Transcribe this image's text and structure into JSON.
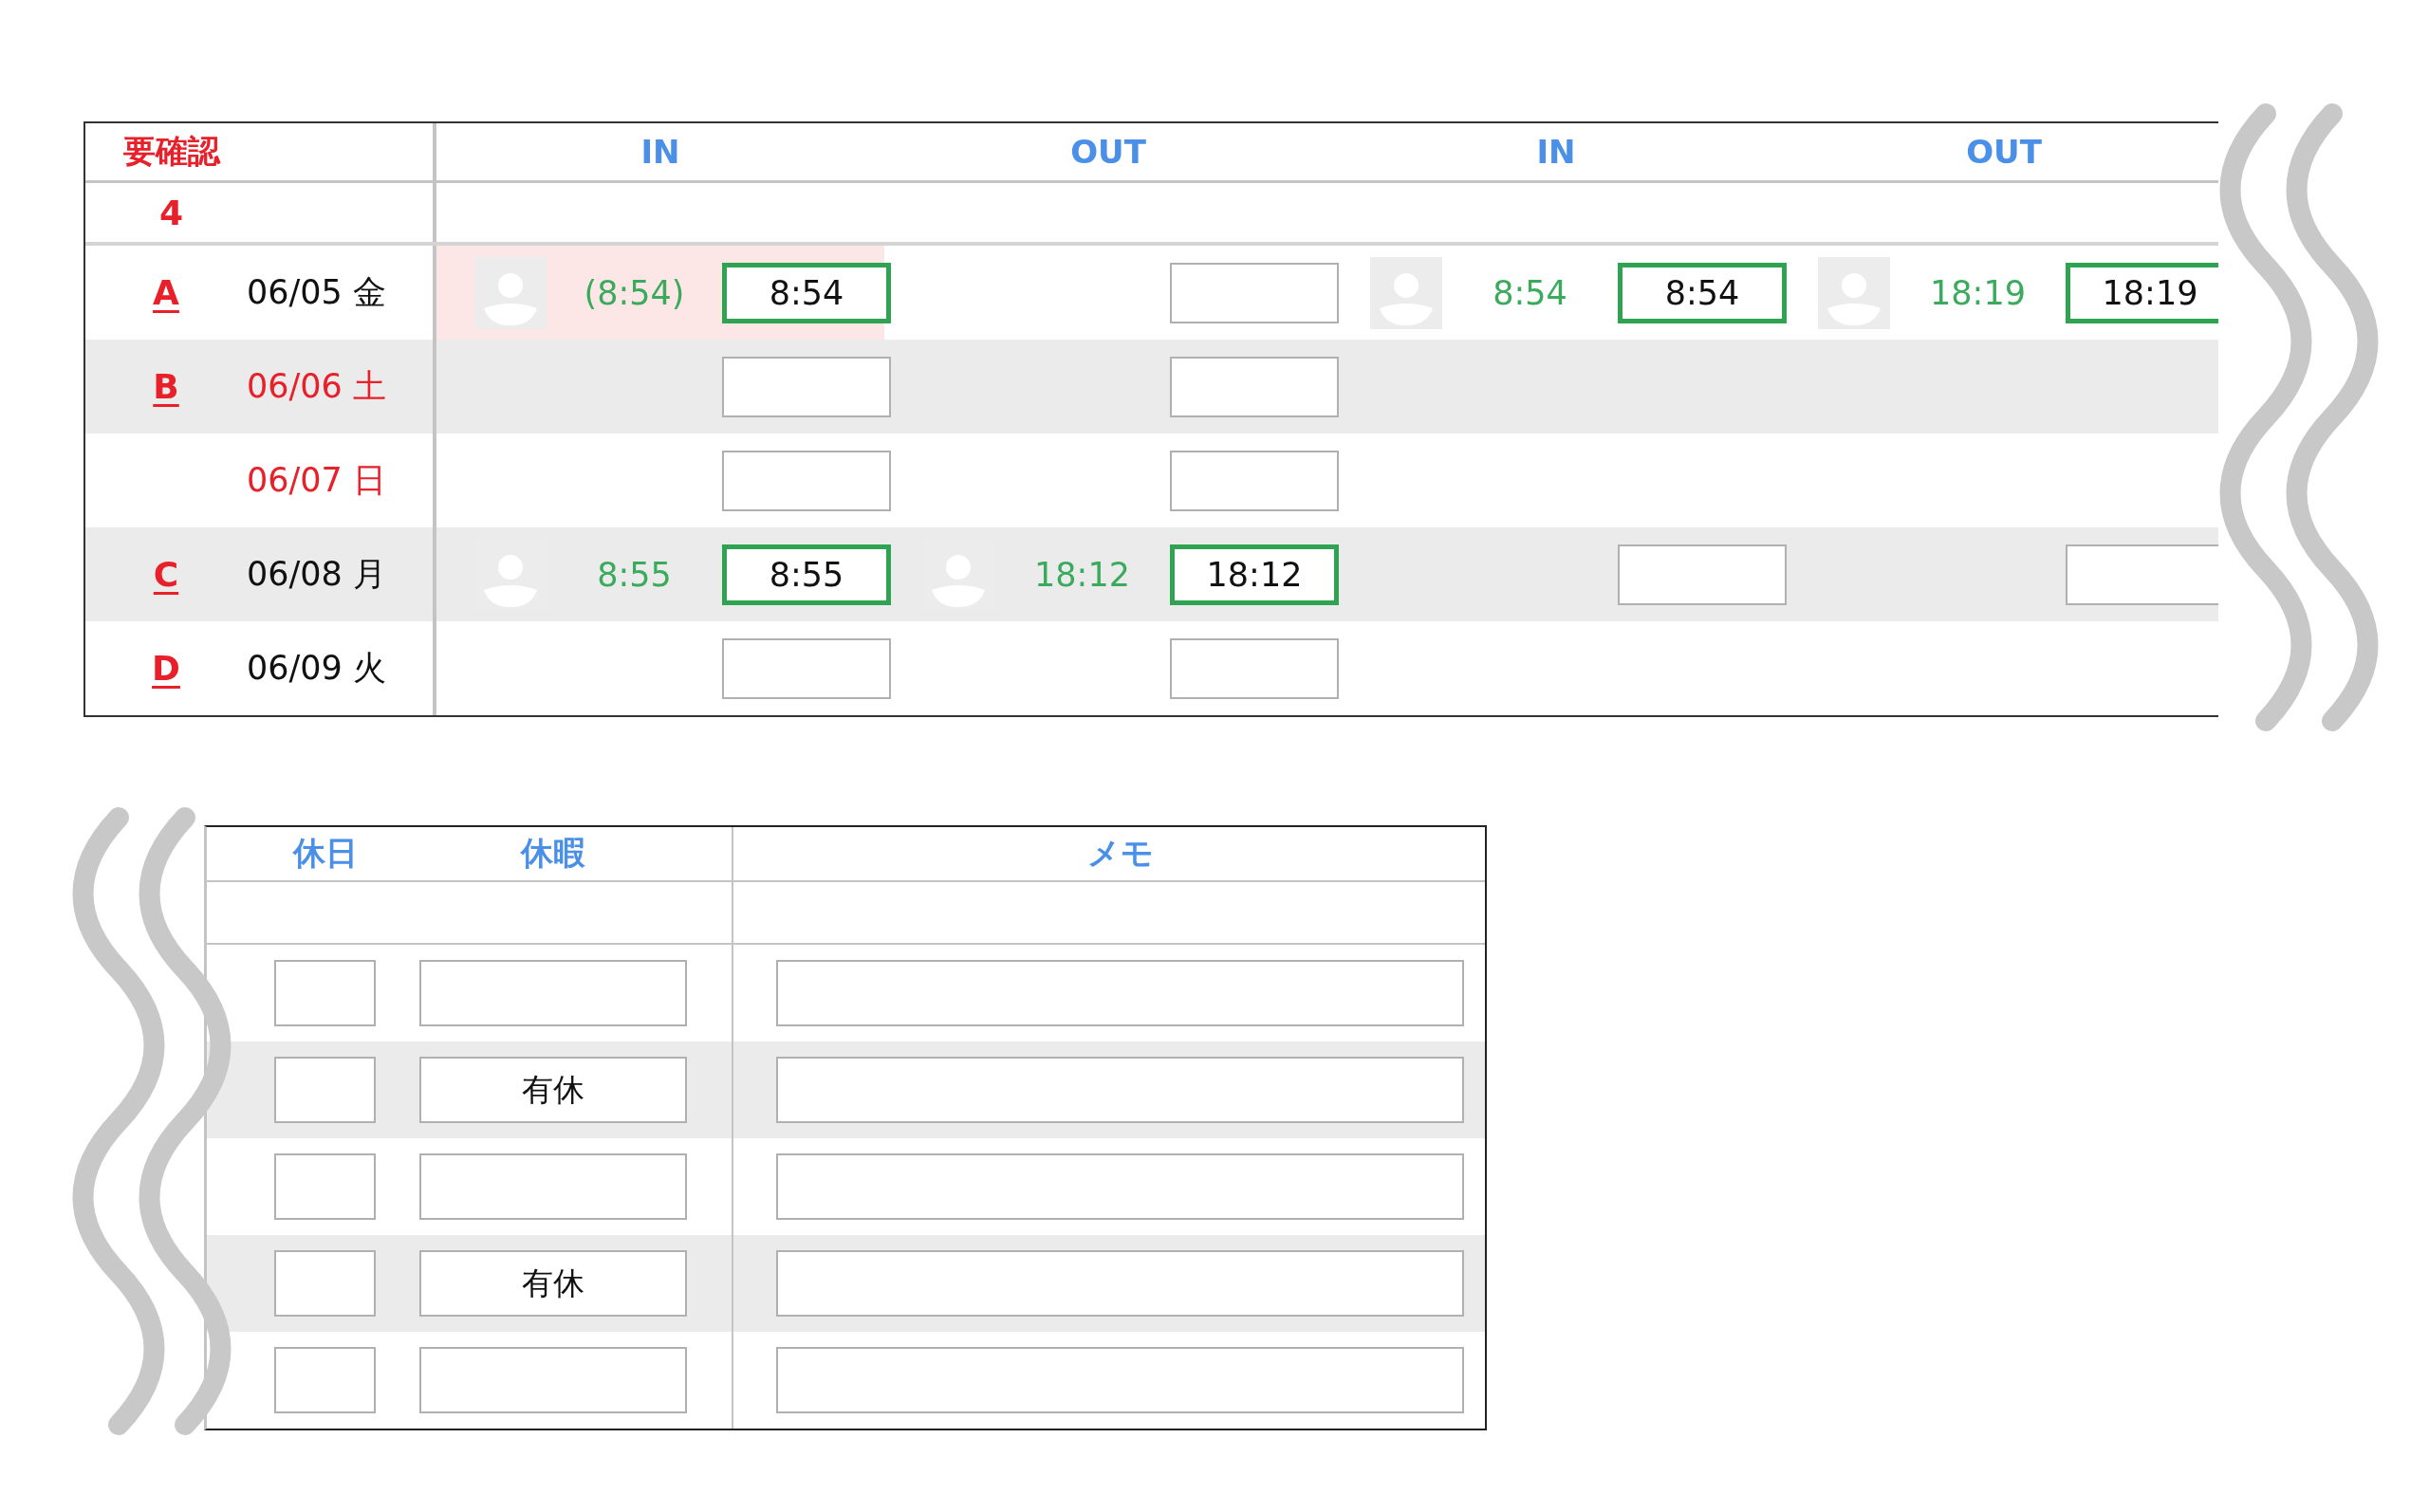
{
  "attendance": {
    "check_header": "要確認",
    "check_count": "4",
    "columns": [
      "IN",
      "OUT",
      "IN",
      "OUT"
    ],
    "rows": [
      {
        "flag": "A",
        "date": "06/05 金",
        "holiday": false,
        "cells": [
          {
            "kind": "entry",
            "photo": true,
            "reading": "(8:54)",
            "value": "8:54",
            "verified": true,
            "flagged": true
          },
          {
            "kind": "entry",
            "photo": false,
            "verified": false,
            "flagged": false
          },
          {
            "kind": "entry",
            "photo": true,
            "reading": "8:54",
            "value": "8:54",
            "verified": true,
            "flagged": false
          },
          {
            "kind": "entry",
            "photo": true,
            "reading": "18:19",
            "value": "18:19",
            "verified": true,
            "flagged": false
          }
        ]
      },
      {
        "flag": "B",
        "date": "06/06 土",
        "holiday": true,
        "cells": [
          {
            "kind": "entry",
            "photo": false,
            "verified": false,
            "flagged": false
          },
          {
            "kind": "entry",
            "photo": false,
            "verified": false,
            "flagged": false
          },
          {
            "kind": "none"
          },
          {
            "kind": "none"
          }
        ]
      },
      {
        "date": "06/07 日",
        "holiday": true,
        "cells": [
          {
            "kind": "entry",
            "photo": false,
            "verified": false,
            "flagged": false
          },
          {
            "kind": "entry",
            "photo": false,
            "verified": false,
            "flagged": false
          },
          {
            "kind": "none"
          },
          {
            "kind": "none"
          }
        ]
      },
      {
        "flag": "C",
        "date": "06/08 月",
        "holiday": false,
        "cells": [
          {
            "kind": "entry",
            "photo": true,
            "reading": "8:55",
            "value": "8:55",
            "verified": true,
            "flagged": false
          },
          {
            "kind": "entry",
            "photo": true,
            "reading": "18:12",
            "value": "18:12",
            "verified": true,
            "flagged": false
          },
          {
            "kind": "entry",
            "photo": false,
            "verified": false,
            "flagged": false
          },
          {
            "kind": "entry",
            "photo": false,
            "verified": false,
            "flagged": false
          }
        ]
      },
      {
        "flag": "D",
        "date": "06/09 火",
        "holiday": false,
        "cells": [
          {
            "kind": "entry",
            "photo": false,
            "verified": false,
            "flagged": false
          },
          {
            "kind": "entry",
            "photo": false,
            "verified": false,
            "flagged": false
          },
          {
            "kind": "none"
          },
          {
            "kind": "none"
          }
        ]
      }
    ]
  },
  "leave": {
    "columns": [
      "休日",
      "休暇",
      "メモ"
    ],
    "rows": [
      {},
      {
        "leave": "有休"
      },
      {},
      {
        "leave": "有休"
      },
      {}
    ]
  }
}
